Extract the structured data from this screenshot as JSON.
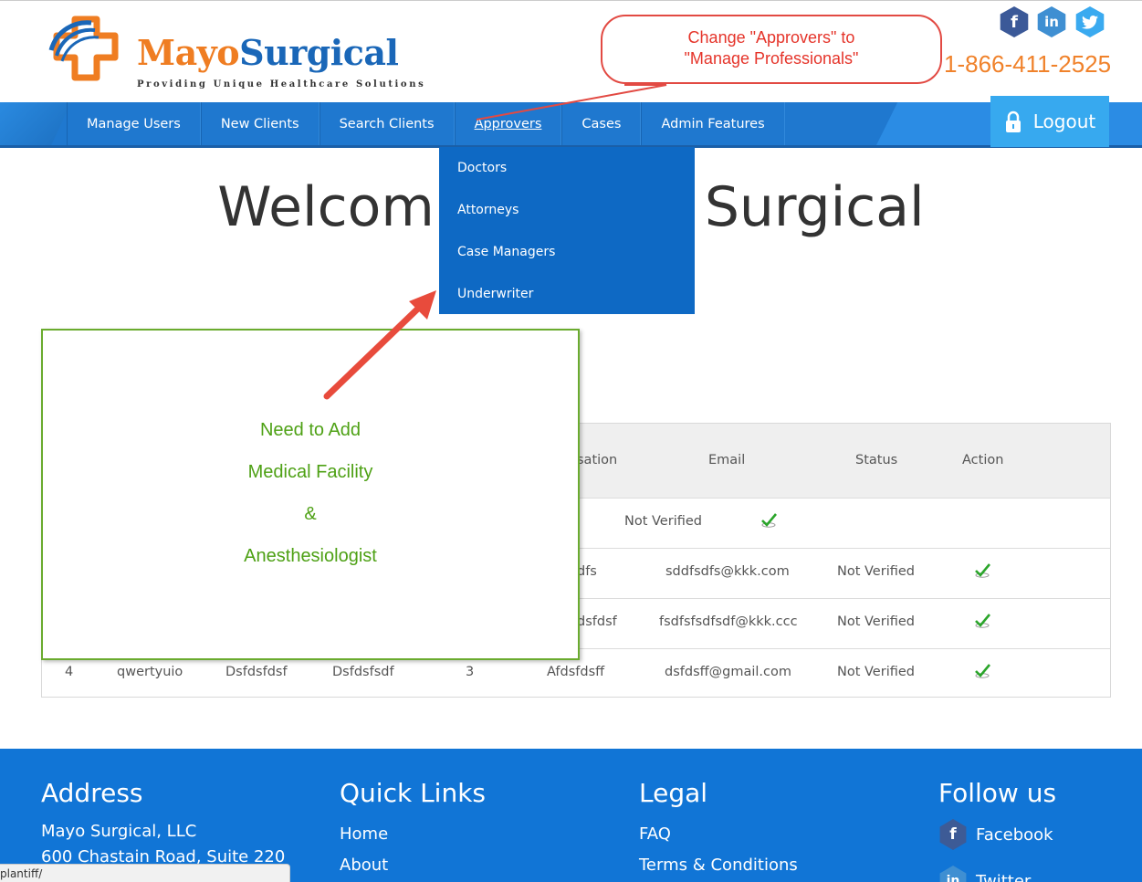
{
  "header": {
    "brand_part1": "Mayo",
    "brand_part2": "Surgical",
    "tagline": "Providing Unique Healthcare Solutions",
    "phone": "1-866-411-2525",
    "social": [
      {
        "icon": "facebook-icon",
        "glyph": "f",
        "color": "#3b5998"
      },
      {
        "icon": "linkedin-icon",
        "glyph": "in",
        "color": "#3f8fd2"
      },
      {
        "icon": "twitter-icon",
        "glyph": "t",
        "color": "#3aaaf0"
      }
    ]
  },
  "nav": {
    "items": [
      "Manage Users",
      "New Clients",
      "Search Clients",
      "Approvers",
      "Cases",
      "Admin Features"
    ],
    "active": "Approvers",
    "logout_label": "Logout"
  },
  "dropdown": {
    "items": [
      "Doctors",
      "Attorneys",
      "Case Managers",
      "Underwriter"
    ]
  },
  "welcome": {
    "left": "Welcom",
    "right": "Surgical"
  },
  "table": {
    "headers": [
      "sation",
      "Email",
      "Status",
      "Action"
    ],
    "row1": {
      "status": "Not Verified"
    },
    "row2": {
      "col": "dfs",
      "email": "sddfsdfs@kkk.com",
      "status": "Not Verified"
    },
    "row3": {
      "col": "dsfdsf",
      "email": "fsdfsfsdfsdf@kkk.ccc",
      "status": "Not Verified"
    },
    "row4": {
      "num": "4",
      "c1": "qwertyuio",
      "c2": "Dsfdsfdsf",
      "c3": "Dsfdsfsdf",
      "c4": "3",
      "c5": "Afdsfdsff",
      "email": "dsfdsff@gmail.com",
      "status": "Not Verified"
    }
  },
  "annotations": {
    "callout_line1": "Change \"Approvers\" to",
    "callout_line2": "\"Manage Professionals\"",
    "note_lines": [
      "Need to Add",
      "Medical Facility",
      "&",
      "Anesthesiologist"
    ],
    "callout_color": "#e5342a",
    "note_color": "#4ea115"
  },
  "footer": {
    "address_head": "Address",
    "address_line1": "Mayo Surgical, LLC",
    "address_line2": "600 Chastain Road, Suite 220",
    "quick_head": "Quick Links",
    "quick_links": [
      "Home",
      "About"
    ],
    "legal_head": "Legal",
    "legal_links": [
      "FAQ",
      "Terms & Conditions"
    ],
    "follow_head": "Follow us",
    "follow_links": [
      "Facebook",
      "Twitter"
    ]
  },
  "status_bar": "plantiff/"
}
